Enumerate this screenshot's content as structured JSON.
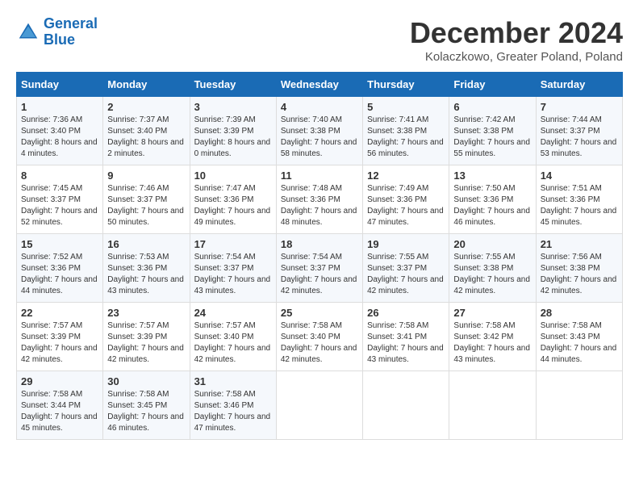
{
  "header": {
    "logo_line1": "General",
    "logo_line2": "Blue",
    "month_title": "December 2024",
    "location": "Kolaczkowo, Greater Poland, Poland"
  },
  "weekdays": [
    "Sunday",
    "Monday",
    "Tuesday",
    "Wednesday",
    "Thursday",
    "Friday",
    "Saturday"
  ],
  "weeks": [
    [
      {
        "day": "1",
        "sunrise": "7:36 AM",
        "sunset": "3:40 PM",
        "daylight": "8 hours and 4 minutes."
      },
      {
        "day": "2",
        "sunrise": "7:37 AM",
        "sunset": "3:40 PM",
        "daylight": "8 hours and 2 minutes."
      },
      {
        "day": "3",
        "sunrise": "7:39 AM",
        "sunset": "3:39 PM",
        "daylight": "8 hours and 0 minutes."
      },
      {
        "day": "4",
        "sunrise": "7:40 AM",
        "sunset": "3:38 PM",
        "daylight": "7 hours and 58 minutes."
      },
      {
        "day": "5",
        "sunrise": "7:41 AM",
        "sunset": "3:38 PM",
        "daylight": "7 hours and 56 minutes."
      },
      {
        "day": "6",
        "sunrise": "7:42 AM",
        "sunset": "3:38 PM",
        "daylight": "7 hours and 55 minutes."
      },
      {
        "day": "7",
        "sunrise": "7:44 AM",
        "sunset": "3:37 PM",
        "daylight": "7 hours and 53 minutes."
      }
    ],
    [
      {
        "day": "8",
        "sunrise": "7:45 AM",
        "sunset": "3:37 PM",
        "daylight": "7 hours and 52 minutes."
      },
      {
        "day": "9",
        "sunrise": "7:46 AM",
        "sunset": "3:37 PM",
        "daylight": "7 hours and 50 minutes."
      },
      {
        "day": "10",
        "sunrise": "7:47 AM",
        "sunset": "3:36 PM",
        "daylight": "7 hours and 49 minutes."
      },
      {
        "day": "11",
        "sunrise": "7:48 AM",
        "sunset": "3:36 PM",
        "daylight": "7 hours and 48 minutes."
      },
      {
        "day": "12",
        "sunrise": "7:49 AM",
        "sunset": "3:36 PM",
        "daylight": "7 hours and 47 minutes."
      },
      {
        "day": "13",
        "sunrise": "7:50 AM",
        "sunset": "3:36 PM",
        "daylight": "7 hours and 46 minutes."
      },
      {
        "day": "14",
        "sunrise": "7:51 AM",
        "sunset": "3:36 PM",
        "daylight": "7 hours and 45 minutes."
      }
    ],
    [
      {
        "day": "15",
        "sunrise": "7:52 AM",
        "sunset": "3:36 PM",
        "daylight": "7 hours and 44 minutes."
      },
      {
        "day": "16",
        "sunrise": "7:53 AM",
        "sunset": "3:36 PM",
        "daylight": "7 hours and 43 minutes."
      },
      {
        "day": "17",
        "sunrise": "7:54 AM",
        "sunset": "3:37 PM",
        "daylight": "7 hours and 43 minutes."
      },
      {
        "day": "18",
        "sunrise": "7:54 AM",
        "sunset": "3:37 PM",
        "daylight": "7 hours and 42 minutes."
      },
      {
        "day": "19",
        "sunrise": "7:55 AM",
        "sunset": "3:37 PM",
        "daylight": "7 hours and 42 minutes."
      },
      {
        "day": "20",
        "sunrise": "7:55 AM",
        "sunset": "3:38 PM",
        "daylight": "7 hours and 42 minutes."
      },
      {
        "day": "21",
        "sunrise": "7:56 AM",
        "sunset": "3:38 PM",
        "daylight": "7 hours and 42 minutes."
      }
    ],
    [
      {
        "day": "22",
        "sunrise": "7:57 AM",
        "sunset": "3:39 PM",
        "daylight": "7 hours and 42 minutes."
      },
      {
        "day": "23",
        "sunrise": "7:57 AM",
        "sunset": "3:39 PM",
        "daylight": "7 hours and 42 minutes."
      },
      {
        "day": "24",
        "sunrise": "7:57 AM",
        "sunset": "3:40 PM",
        "daylight": "7 hours and 42 minutes."
      },
      {
        "day": "25",
        "sunrise": "7:58 AM",
        "sunset": "3:40 PM",
        "daylight": "7 hours and 42 minutes."
      },
      {
        "day": "26",
        "sunrise": "7:58 AM",
        "sunset": "3:41 PM",
        "daylight": "7 hours and 43 minutes."
      },
      {
        "day": "27",
        "sunrise": "7:58 AM",
        "sunset": "3:42 PM",
        "daylight": "7 hours and 43 minutes."
      },
      {
        "day": "28",
        "sunrise": "7:58 AM",
        "sunset": "3:43 PM",
        "daylight": "7 hours and 44 minutes."
      }
    ],
    [
      {
        "day": "29",
        "sunrise": "7:58 AM",
        "sunset": "3:44 PM",
        "daylight": "7 hours and 45 minutes."
      },
      {
        "day": "30",
        "sunrise": "7:58 AM",
        "sunset": "3:45 PM",
        "daylight": "7 hours and 46 minutes."
      },
      {
        "day": "31",
        "sunrise": "7:58 AM",
        "sunset": "3:46 PM",
        "daylight": "7 hours and 47 minutes."
      },
      null,
      null,
      null,
      null
    ]
  ]
}
